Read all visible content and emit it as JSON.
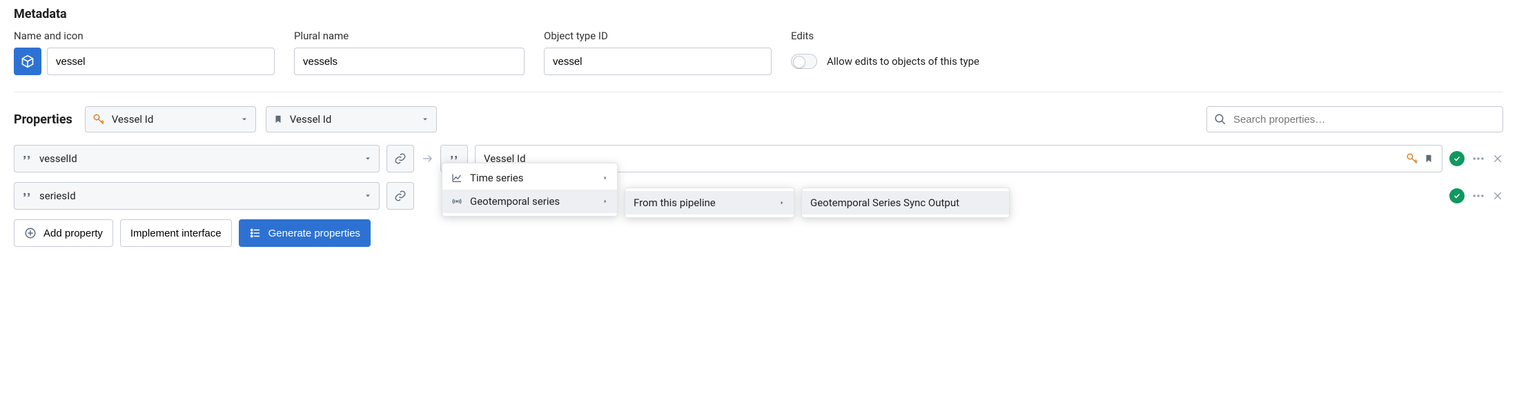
{
  "metadata": {
    "section_title": "Metadata",
    "name_and_icon_label": "Name and icon",
    "name_value": "vessel",
    "plural_label": "Plural name",
    "plural_value": "vessels",
    "object_type_label": "Object type ID",
    "object_type_value": "vessel",
    "edits_label": "Edits",
    "allow_edits_label": "Allow edits to objects of this type",
    "allow_edits_on": false
  },
  "properties": {
    "section_title": "Properties",
    "key_selector_label": "Vessel Id",
    "title_selector_label": "Vessel Id",
    "search_placeholder": "Search properties…",
    "rows": [
      {
        "source": "vesselId",
        "display_name": "Vessel Id"
      },
      {
        "source": "seriesId",
        "display_name": ""
      }
    ]
  },
  "buttons": {
    "add_property": "Add property",
    "implement_interface": "Implement interface",
    "generate_properties": "Generate properties"
  },
  "menus": {
    "series_menu": [
      {
        "icon": "line-chart",
        "label": "Time series",
        "has_children": true,
        "hover": false
      },
      {
        "icon": "broadcast",
        "label": "Geotemporal series",
        "has_children": true,
        "hover": true
      }
    ],
    "source_menu": [
      {
        "label": "From this pipeline",
        "has_children": true,
        "hover": true
      }
    ],
    "output_menu": [
      {
        "label": "Geotemporal Series Sync Output",
        "hover": true
      }
    ]
  }
}
